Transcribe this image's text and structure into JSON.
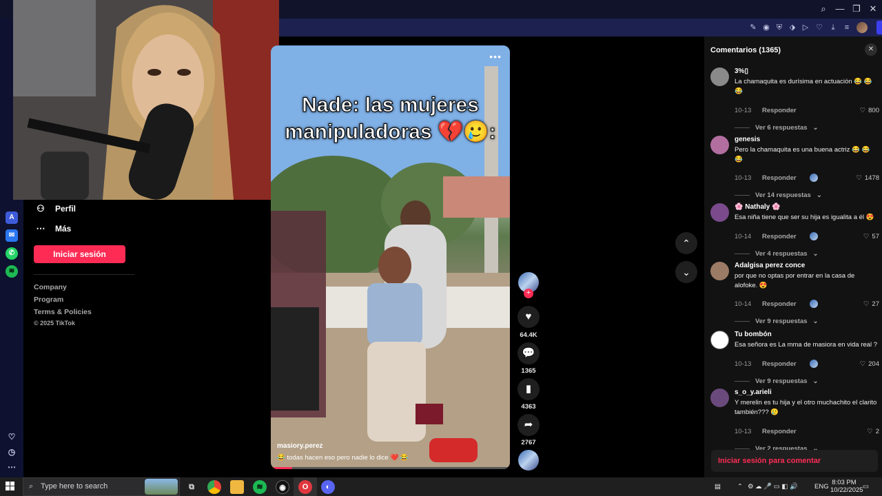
{
  "window": {
    "tray_buttons": [
      "⌕",
      "—",
      "❐",
      "✕"
    ]
  },
  "toolbar_icons": [
    "✎",
    "◉",
    "⛨",
    "⬗",
    "▷",
    "♡",
    "⤓",
    "≡"
  ],
  "sidebar_nav": [
    {
      "label": "Perfil",
      "icon": "person-icon"
    },
    {
      "label": "Más",
      "icon": "more-icon"
    }
  ],
  "login_button": "Iniciar sesión",
  "footer_links": [
    "Company",
    "Program",
    "Terms & Policies"
  ],
  "copyright": "© 2025 TikTok",
  "video": {
    "overlay_line1": "Nade: las mujeres",
    "overlay_line2": "manipuladoras 💔🥲:",
    "author": "masiory.perez",
    "caption": "😂 todas hacen eso pero nadie lo dice ❤️ 😂",
    "more_label": "•••"
  },
  "actions": {
    "likes": "64.4K",
    "comments": "1365",
    "saves": "4363",
    "shares": "2767"
  },
  "comments_panel": {
    "title": "Comentarios (1365)",
    "reply_label": "Responder",
    "login_prompt": "Iniciar sesión para comentar",
    "items": [
      {
        "user": "3%▯",
        "text": "La chamaquita es durísima en actuación 😂 😂 😂",
        "date": "10-13",
        "likes": "800",
        "replies": "Ver 6 respuestas",
        "creator_liked": false,
        "avatar_color": "#8a8a8a"
      },
      {
        "user": "genesis",
        "text": "Pero la chamaquita es una buena actriz 😂 😂 😂",
        "date": "10-13",
        "likes": "1478",
        "replies": "Ver 14 respuestas",
        "creator_liked": true,
        "avatar_color": "#b36ea0"
      },
      {
        "user": "🌸 Nathaly 🌸",
        "text": "Esa niña tiene que ser su hija es igualita a él 😍",
        "date": "10-14",
        "likes": "57",
        "replies": "Ver 4 respuestas",
        "creator_liked": true,
        "avatar_color": "#7a4a8c"
      },
      {
        "user": "Adalgisa perez conce",
        "text": "por que no optas por entrar en la casa de alofoke. 😍",
        "date": "10-14",
        "likes": "27",
        "replies": "Ver 9 respuestas",
        "creator_liked": true,
        "avatar_color": "#9c7b66"
      },
      {
        "user": "Tu bombón",
        "text": "Esa señora es La mma de masiora en vida real ?",
        "date": "10-13",
        "likes": "204",
        "replies": "Ver 9 respuestas",
        "creator_liked": true,
        "avatar_color": "#ffffff"
      },
      {
        "user": "s_o_y.arieli",
        "text": "Y merelin es tu hija y el otro muchachito el clarito también??? 🥲",
        "date": "10-13",
        "likes": "2",
        "replies": "Ver 2 respuestas",
        "creator_liked": false,
        "avatar_color": "#6a4a7c"
      }
    ]
  },
  "taskbar": {
    "search_placeholder": "Type here to search",
    "language": "ENG",
    "time": "8:03 PM",
    "date": "10/22/2025"
  },
  "colors": {
    "accent": "#fe2c55",
    "titlebar": "#10132a",
    "addressbar": "#1d2150",
    "comments_bg": "#121212"
  }
}
